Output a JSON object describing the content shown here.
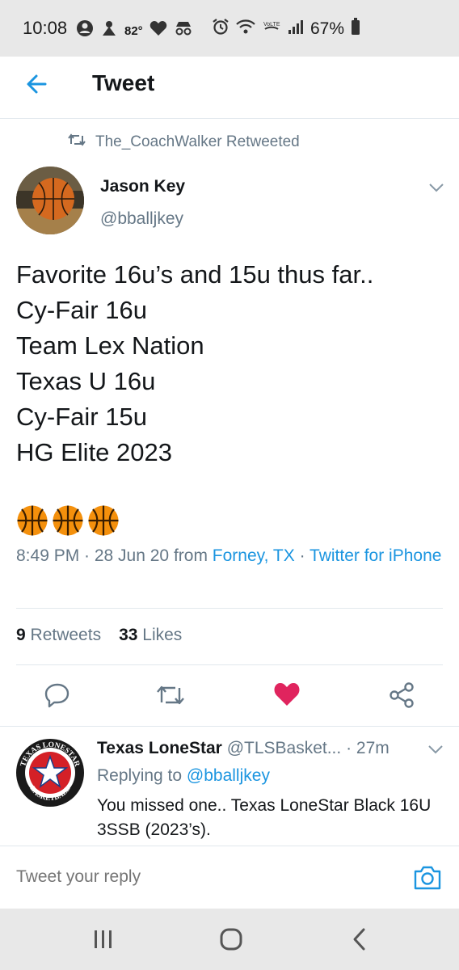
{
  "status_bar": {
    "time": "10:08",
    "temperature": "82°",
    "battery_percent": "67%"
  },
  "header": {
    "title": "Tweet",
    "back_icon": "arrow-left-icon"
  },
  "retweet_context": {
    "text": "The_CoachWalker Retweeted"
  },
  "tweet": {
    "author_name": "Jason Key",
    "author_handle": "@bballjkey",
    "text": "Favorite 16u’s and 15u thus far..\nCy-Fair 16u\nTeam Lex Nation\nTexas U 16u\nCy-Fair 15u\nHG Elite 2023",
    "emoji_count": 3,
    "emoji_name": "basketball",
    "time": "8:49 PM · 28 Jun 20 from ",
    "location": "Forney, TX",
    "separator": " · ",
    "source": "Twitter for iPhone",
    "retweets_count": "9",
    "retweets_label": "Retweets",
    "likes_count": "33",
    "likes_label": "Likes",
    "liked": true
  },
  "reply": {
    "author_name": "Texas LoneStar",
    "author_handle": "@TLSBasket...",
    "time": "· 27m",
    "replying_to_label": "Replying to ",
    "replying_to_handle": "@bballjkey",
    "text": "You missed one.. Texas LoneStar Black 16U 3SSB (2023’s).",
    "logo_top_text": "TEXAS LONESTAR",
    "logo_bottom_text": "BASKETBALL"
  },
  "compose": {
    "placeholder": "Tweet your reply"
  },
  "colors": {
    "accent": "#1b95e0",
    "like": "#e0245e",
    "secondary_text": "#657786"
  }
}
